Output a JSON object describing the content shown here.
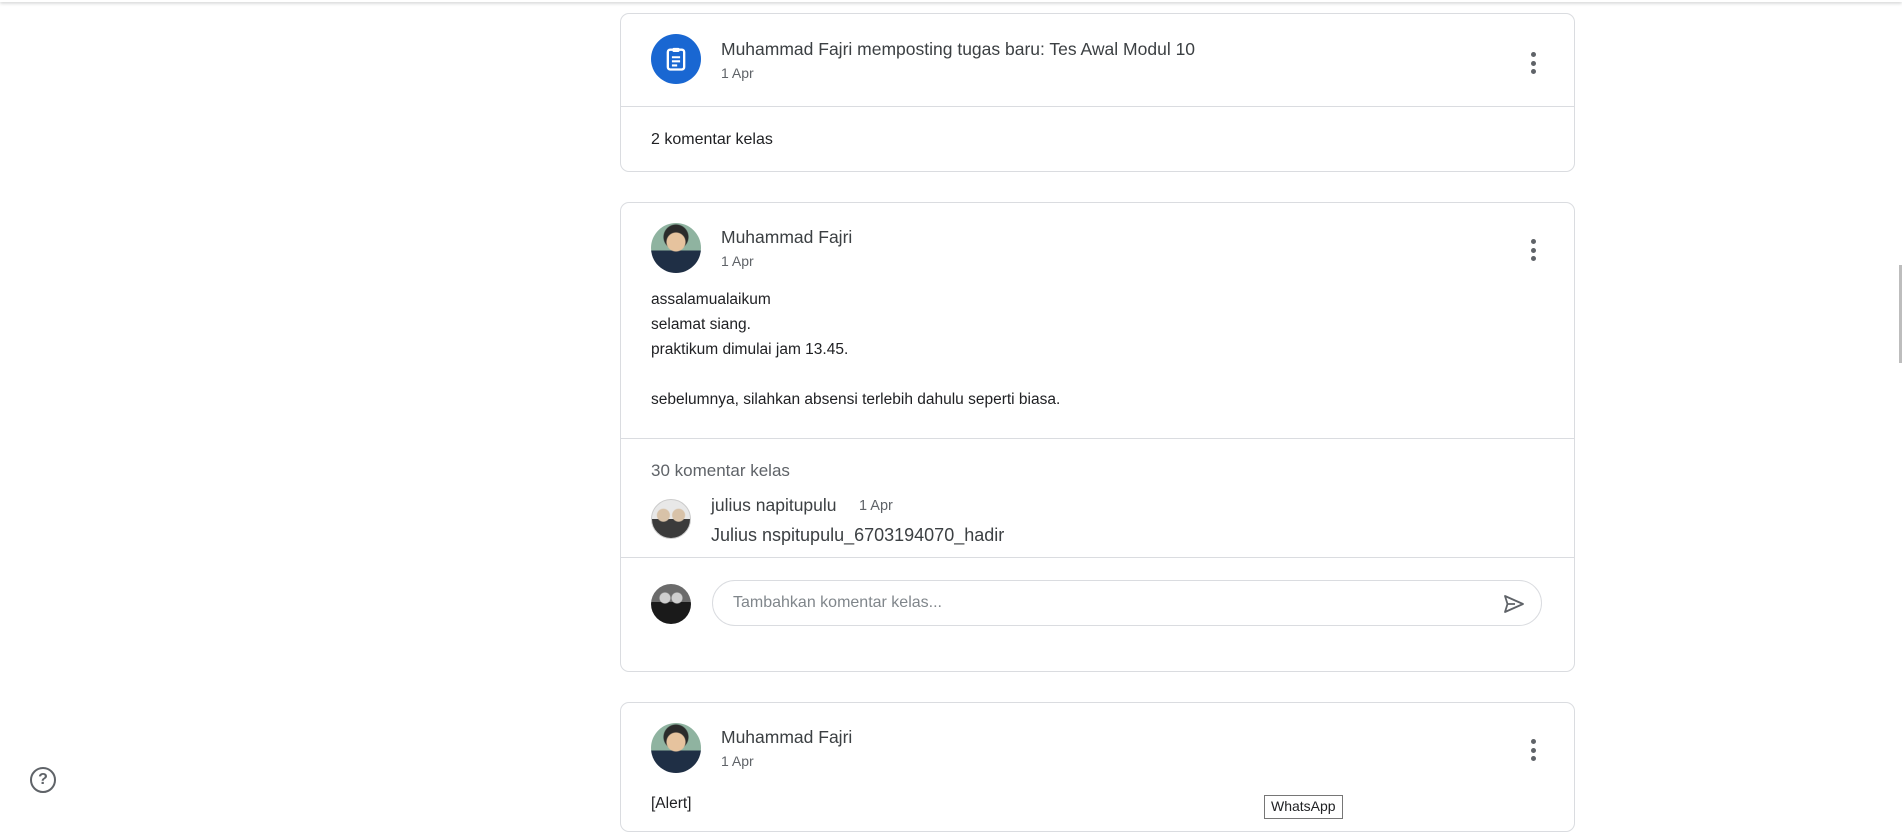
{
  "posts": [
    {
      "author_line": "Muhammad Fajri memposting tugas baru: Tes Awal Modul 10",
      "date": "1 Apr",
      "comment_count": "2 komentar kelas"
    },
    {
      "author": "Muhammad Fajri",
      "date": "1 Apr",
      "body": "assalamualaikum\nselamat siang.\npraktikum dimulai jam 13.45.\n\nsebelumnya, silahkan absensi terlebih dahulu seperti biasa.",
      "comment_count": "30 komentar kelas",
      "comment": {
        "name": "julius napitupulu",
        "date": "1 Apr",
        "text": "Julius nspitupulu_6703194070_hadir"
      },
      "add_comment_placeholder": "Tambahkan komentar kelas..."
    },
    {
      "author": "Muhammad Fajri",
      "date": "1 Apr",
      "body": "[Alert]"
    }
  ],
  "help_label": "?",
  "tooltip": "WhatsApp",
  "colors": {
    "accent": "#1967d2",
    "border": "#dadce0",
    "text": "#202124",
    "secondary": "#5f6368"
  }
}
